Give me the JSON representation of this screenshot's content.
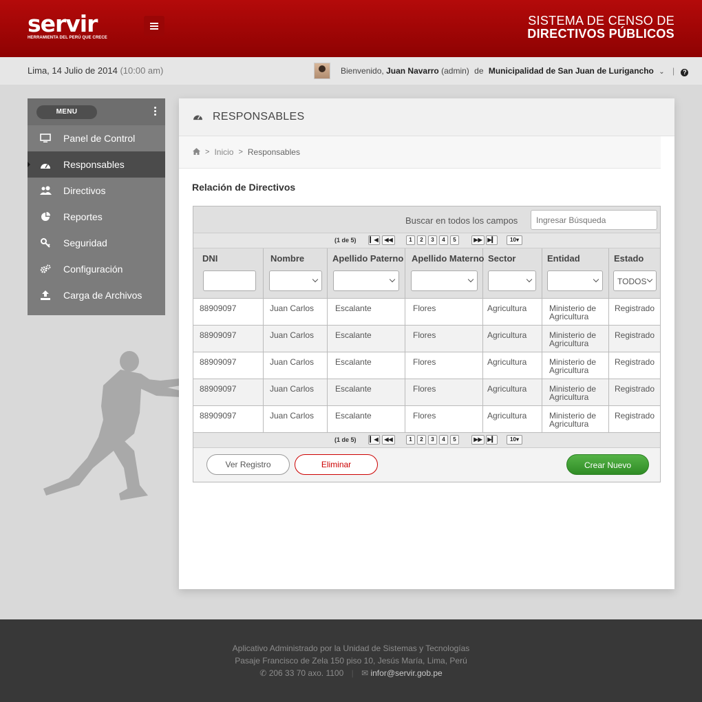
{
  "header": {
    "logo_word": "servir",
    "logo_tagline": "HERRAMIENTA DEL PERÚ QUE CRECE",
    "system_line1": "SISTEMA DE CENSO  DE",
    "system_line2": "DIRECTIVOS PÚBLICOS"
  },
  "infobar": {
    "date": "Lima, 14 Julio de 2014",
    "time": "(10:00 am)",
    "welcome_prefix": "Bienvenido,",
    "user_name": "Juan Navarro",
    "user_role": "(admin)",
    "de": "de",
    "organization": "Municipalidad de San Juan de Lurigancho"
  },
  "sidebar": {
    "menu_label": "MENU",
    "items": [
      {
        "label": "Panel de Control",
        "icon": "monitor-icon"
      },
      {
        "label": "Responsables",
        "icon": "dashboard-icon"
      },
      {
        "label": "Directivos",
        "icon": "users-icon"
      },
      {
        "label": "Reportes",
        "icon": "pie-chart-icon"
      },
      {
        "label": "Seguridad",
        "icon": "key-icon"
      },
      {
        "label": "Configuración",
        "icon": "gears-icon"
      },
      {
        "label": "Carga de Archivos",
        "icon": "upload-icon"
      }
    ],
    "active_index": 1
  },
  "main": {
    "title": "RESPONSABLES",
    "breadcrumb": [
      "Inicio",
      "Responsables"
    ],
    "section_title": "Relación de Directivos",
    "search_label": "Buscar en todos los campos",
    "search_placeholder": "Ingresar Búsqueda",
    "pager": {
      "count": "(1 de 5)",
      "pages": [
        "1",
        "2",
        "3",
        "4",
        "5"
      ],
      "page_size": "10"
    },
    "columns": [
      "DNI",
      "Nombre",
      "Apellido Paterno",
      "Apellido Materno",
      "Sector",
      "Entidad",
      "Estado"
    ],
    "estado_filter": "TODOS",
    "rows": [
      {
        "dni": "88909097",
        "nombre": "Juan Carlos",
        "paterno": "Escalante",
        "materno": "Flores",
        "sector": "Agricultura",
        "entidad_1": "Ministerio de",
        "entidad_2": "Agricultura",
        "estado": "Registrado"
      },
      {
        "dni": "88909097",
        "nombre": "Juan Carlos",
        "paterno": "Escalante",
        "materno": "Flores",
        "sector": "Agricultura",
        "entidad_1": "Ministerio de",
        "entidad_2": "Agricultura",
        "estado": "Registrado"
      },
      {
        "dni": "88909097",
        "nombre": "Juan Carlos",
        "paterno": "Escalante",
        "materno": "Flores",
        "sector": "Agricultura",
        "entidad_1": "Ministerio de",
        "entidad_2": "Agricultura",
        "estado": "Registrado"
      },
      {
        "dni": "88909097",
        "nombre": "Juan Carlos",
        "paterno": "Escalante",
        "materno": "Flores",
        "sector": "Agricultura",
        "entidad_1": "Ministerio de",
        "entidad_2": "Agricultura",
        "estado": "Registrado"
      },
      {
        "dni": "88909097",
        "nombre": "Juan Carlos",
        "paterno": "Escalante",
        "materno": "Flores",
        "sector": "Agricultura",
        "entidad_1": "Ministerio de",
        "entidad_2": "Agricultura",
        "estado": "Registrado"
      }
    ],
    "buttons": {
      "ver": "Ver Registro",
      "eliminar": "Eliminar",
      "crear": "Crear Nuevo"
    }
  },
  "footer": {
    "line1": "Aplicativo Administrado por la Unidad de Sistemas y Tecnologías",
    "line2": "Pasaje Francisco de Zela 150 piso 10, Jesús María, Lima, Perú",
    "phone": "206 33 70 axo. 1100",
    "email": "infor@servir.gob.pe"
  },
  "colors": {
    "brand_red": "#a50505",
    "active_green": "#3a9a2e",
    "danger": "#cc0000"
  }
}
